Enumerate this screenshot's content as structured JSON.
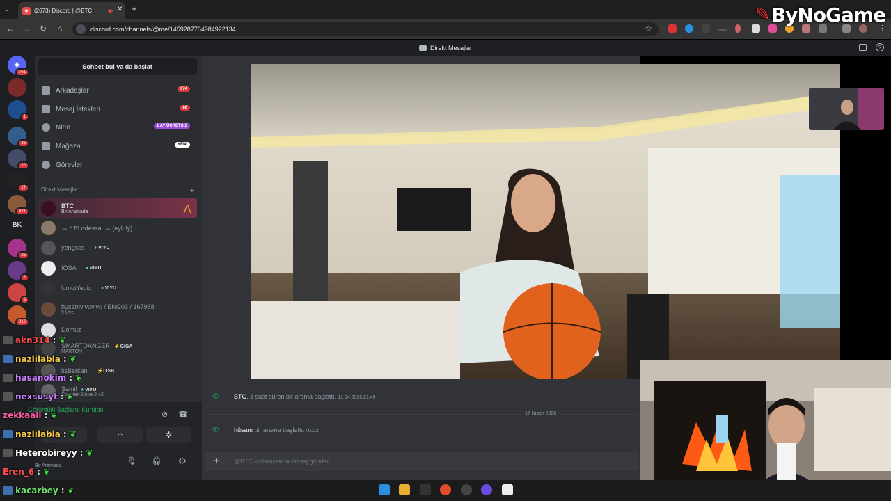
{
  "browser": {
    "tab_title": "(2673) Discord | @BTC",
    "url": "discord.com/channels/@me/1459287764984922134"
  },
  "discord": {
    "window_title": "Direkt Mesajlar",
    "search_label": "Sohbet bul ya da başlat",
    "servers": [
      {
        "badge": "761"
      },
      {
        "badge": ""
      },
      {
        "badge": "1"
      },
      {
        "badge": "36"
      },
      {
        "badge": "10"
      },
      {
        "badge": "27"
      },
      {
        "badge": "421"
      },
      {
        "label": "BK",
        "badge": ""
      },
      {
        "badge": "25"
      },
      {
        "badge": "2"
      },
      {
        "badge": "3"
      },
      {
        "badge": "312"
      }
    ],
    "nav": [
      {
        "label": "Arkadaşlar",
        "pill": "674"
      },
      {
        "label": "Mesaj İstekleri",
        "pill": "86"
      },
      {
        "label": "Nitro",
        "pill": "1 AY ÜCRETSİZ"
      },
      {
        "label": "Mağaza",
        "pill": "YENİ"
      },
      {
        "label": "Görevler",
        "pill": ""
      }
    ],
    "dm_header": "Direkt Mesajlar",
    "dm_add": "+",
    "dms": [
      {
        "name": "BTC",
        "sub": "Bir Aramada"
      },
      {
        "name": "ᯓ ⁺ ᗢ odessa' ᯓ (eyluly)",
        "sub": ""
      },
      {
        "name": "yengsos",
        "tag": "VIYU"
      },
      {
        "name": "!OSA",
        "tag": "VIYU"
      },
      {
        "name": "UmutYedix",
        "tag": "VIYU"
      },
      {
        "name": "husamviyuviyu / ENG03 / 167988",
        "sub": "9 Üye"
      },
      {
        "name": "Domuz"
      },
      {
        "name": "SMARTDANGER",
        "tag": "GIGA",
        "sub": "MARTON"
      },
      {
        "name": "itsBerkan",
        "tag": "ITSB"
      },
      {
        "name": "Şamil",
        "tag": "VIYU",
        "sub": "Counter-Strike 2 +2"
      }
    ],
    "voice_status": "Görüntülü Bağlantı Kuruldu",
    "user_status": "Bir Aramada",
    "log": [
      {
        "name": "BTC",
        "text": ", 3 saat süren bir arama başlattı.",
        "time": "11.04.2026 21:49"
      },
      {
        "name": "hüsam",
        "text": " bir arama başlattı.",
        "time": "01:22"
      }
    ],
    "date_divider": "17 Nisan 2026",
    "message_placeholder": "@BTC kullanıcısına mesaj gönder"
  },
  "chat_overlay": [
    {
      "user": "akn314",
      "color": "#ff4d4d"
    },
    {
      "user": "nazlilabla",
      "color": "#f7c948"
    },
    {
      "user": "hasanokim",
      "color": "#c77dff"
    },
    {
      "user": "nexsusyt",
      "color": "#c77dff"
    },
    {
      "user": "zekkaall",
      "color": "#ff5ca8"
    },
    {
      "user": "nazlilabla",
      "color": "#f7c948"
    },
    {
      "user": "Heterobireyy",
      "color": "#ffffff"
    },
    {
      "user": "Eren_6",
      "color": "#ff4d4d"
    },
    {
      "user": "kacarbey",
      "color": "#6ee06e"
    }
  ],
  "brand": "ByNoGame"
}
